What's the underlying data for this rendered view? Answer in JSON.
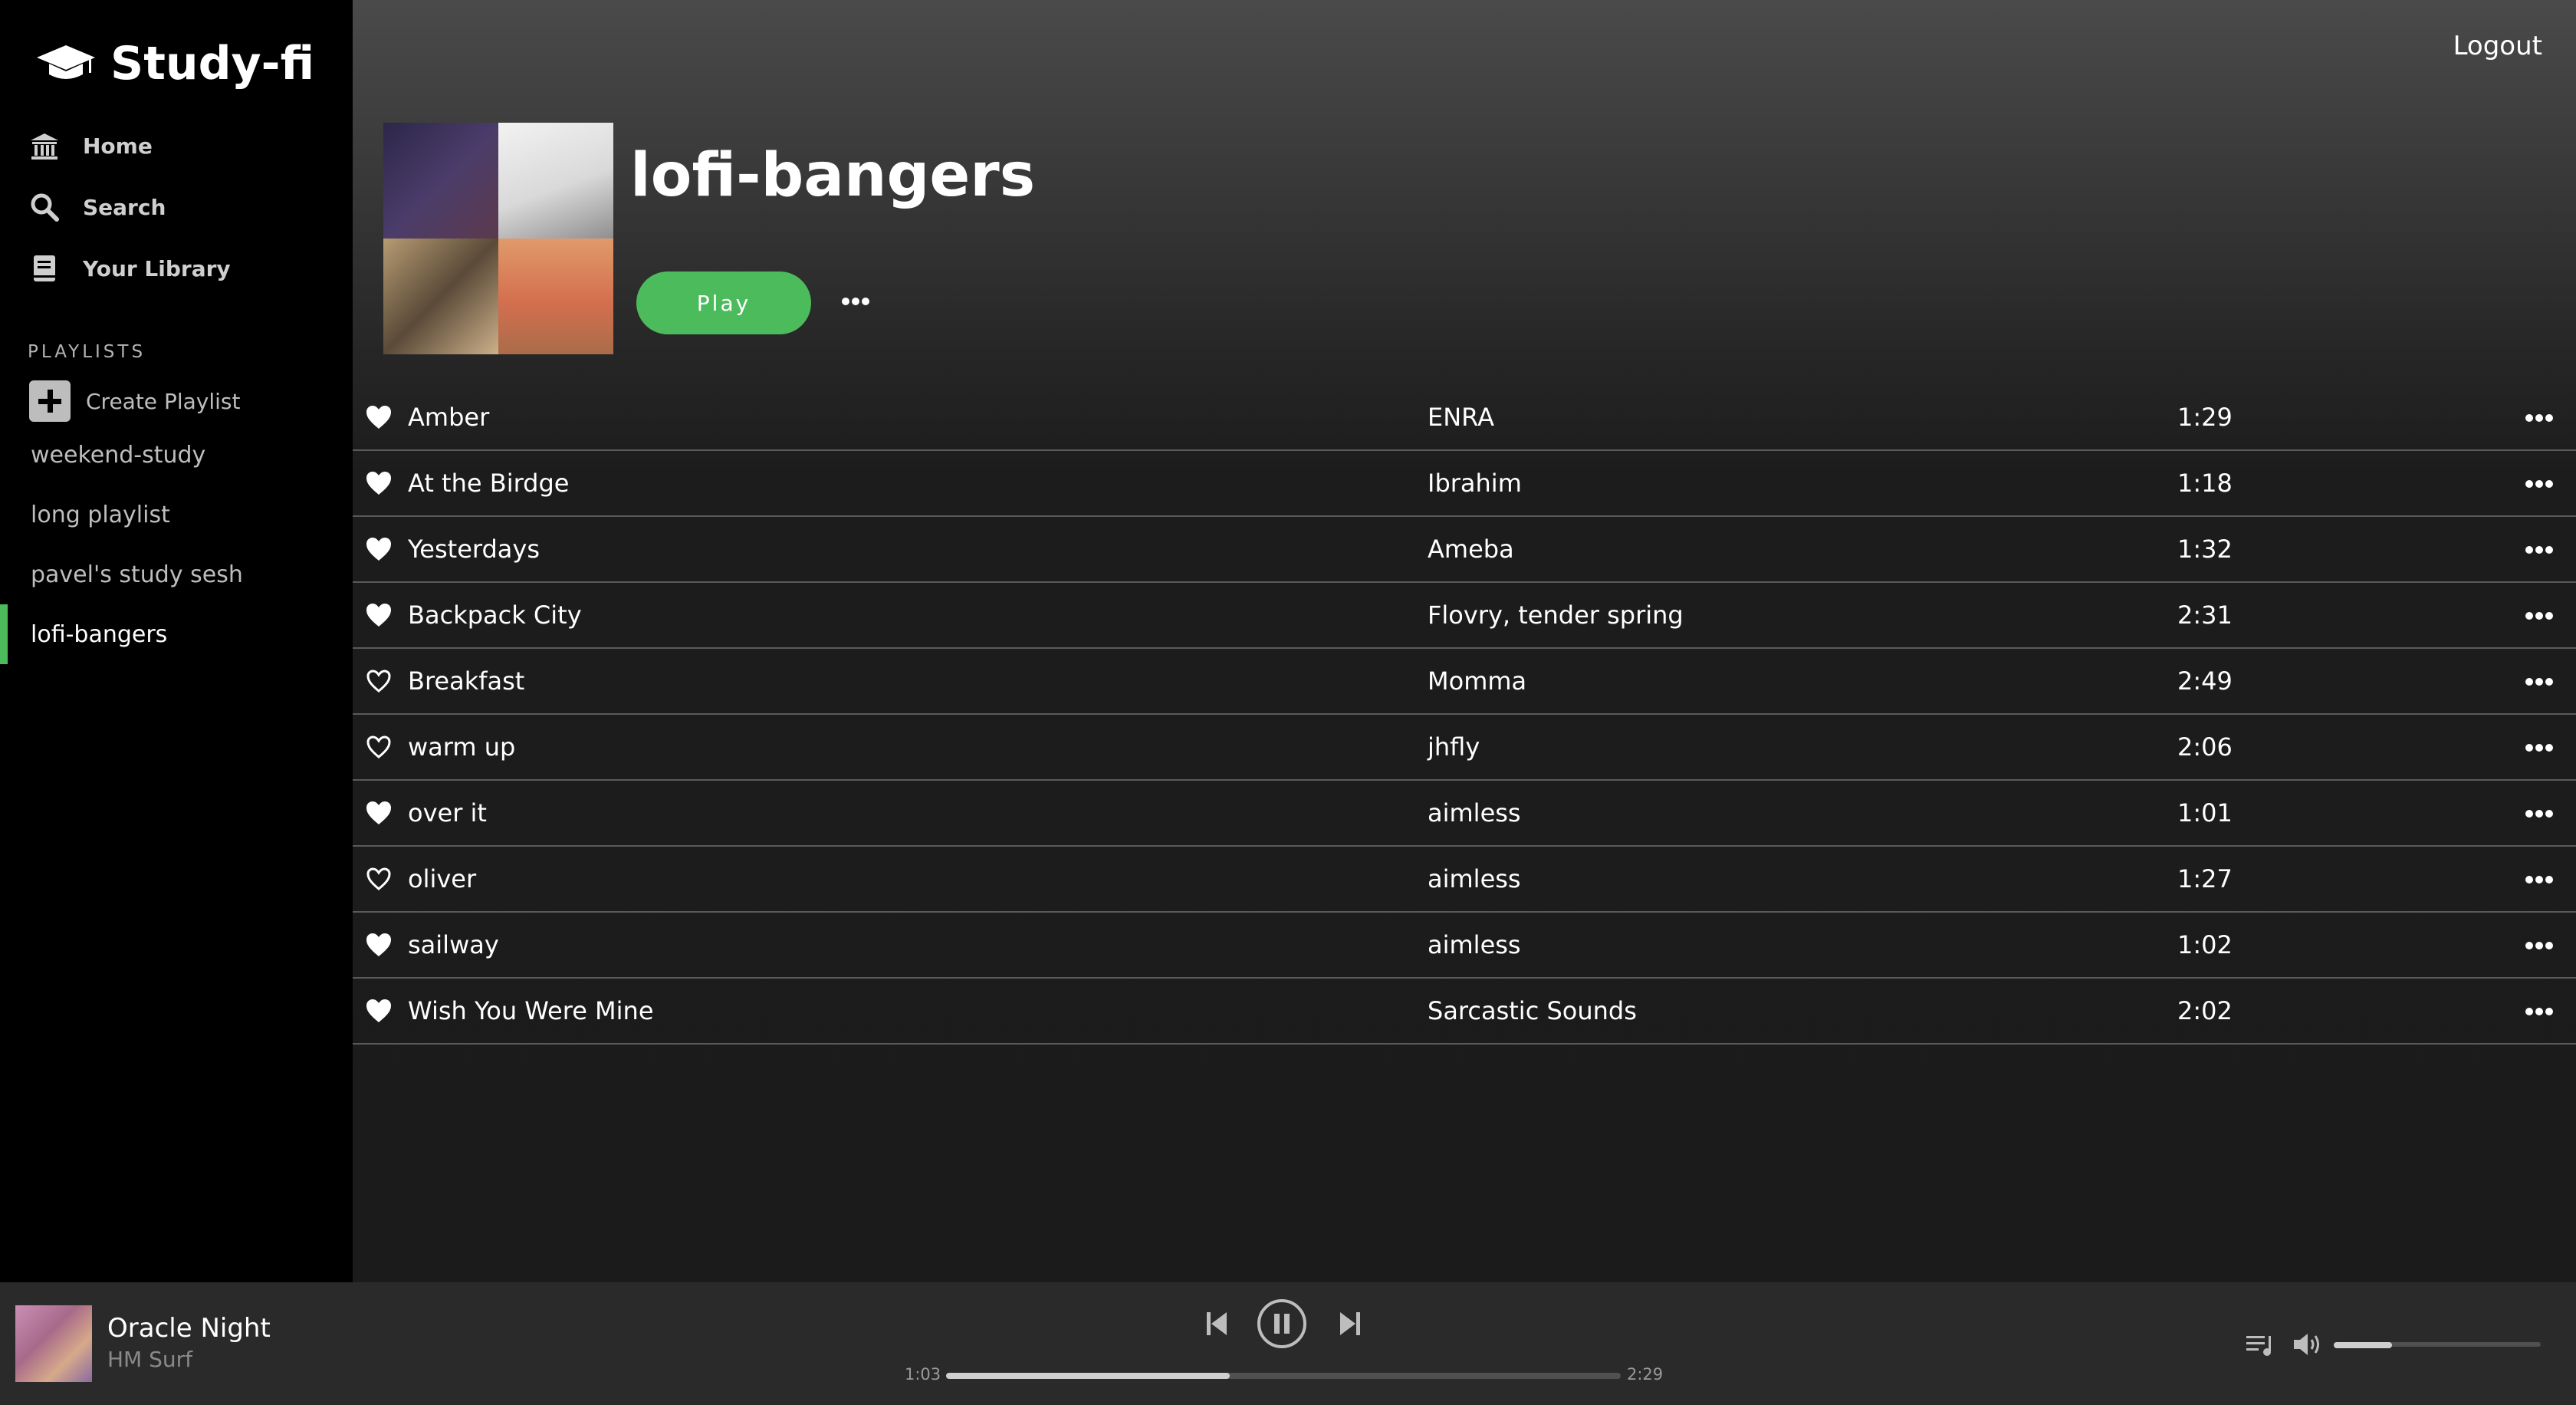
{
  "app": {
    "name": "Study-fi"
  },
  "nav": {
    "home": "Home",
    "search": "Search",
    "library": "Your Library"
  },
  "sidebar": {
    "section_label": "PLAYLISTS",
    "create_playlist": "Create Playlist",
    "playlists": [
      "weekend-study",
      "long playlist",
      "pavel's study sesh",
      "lofi-bangers"
    ],
    "active_playlist": "lofi-bangers"
  },
  "header": {
    "logout": "Logout",
    "playlist_title": "lofi-bangers",
    "play_label": "Play"
  },
  "tracks": [
    {
      "name": "Amber",
      "artist": "ENRA",
      "duration": "1:29",
      "liked": true
    },
    {
      "name": "At the Birdge",
      "artist": "Ibrahim",
      "duration": "1:18",
      "liked": true
    },
    {
      "name": "Yesterdays",
      "artist": "Ameba",
      "duration": "1:32",
      "liked": true
    },
    {
      "name": "Backpack City",
      "artist": "Flovry, tender spring",
      "duration": "2:31",
      "liked": true
    },
    {
      "name": "Breakfast",
      "artist": "Momma",
      "duration": "2:49",
      "liked": false
    },
    {
      "name": "warm up",
      "artist": "jhfly",
      "duration": "2:06",
      "liked": false
    },
    {
      "name": "over it",
      "artist": "aimless",
      "duration": "1:01",
      "liked": true
    },
    {
      "name": "oliver",
      "artist": "aimless",
      "duration": "1:27",
      "liked": false
    },
    {
      "name": "sailway",
      "artist": "aimless",
      "duration": "1:02",
      "liked": true
    },
    {
      "name": "Wish You Were Mine",
      "artist": "Sarcastic Sounds",
      "duration": "2:02",
      "liked": true
    }
  ],
  "player": {
    "track_title": "Oracle Night",
    "track_artist": "HM Surf",
    "elapsed": "1:03",
    "total": "2:29",
    "progress_fraction": 0.42,
    "volume_fraction": 0.28,
    "state": "playing"
  },
  "colors": {
    "accent": "#4cbb5c",
    "sidebar_bg": "#000000",
    "player_bg": "#2a2a2a"
  }
}
